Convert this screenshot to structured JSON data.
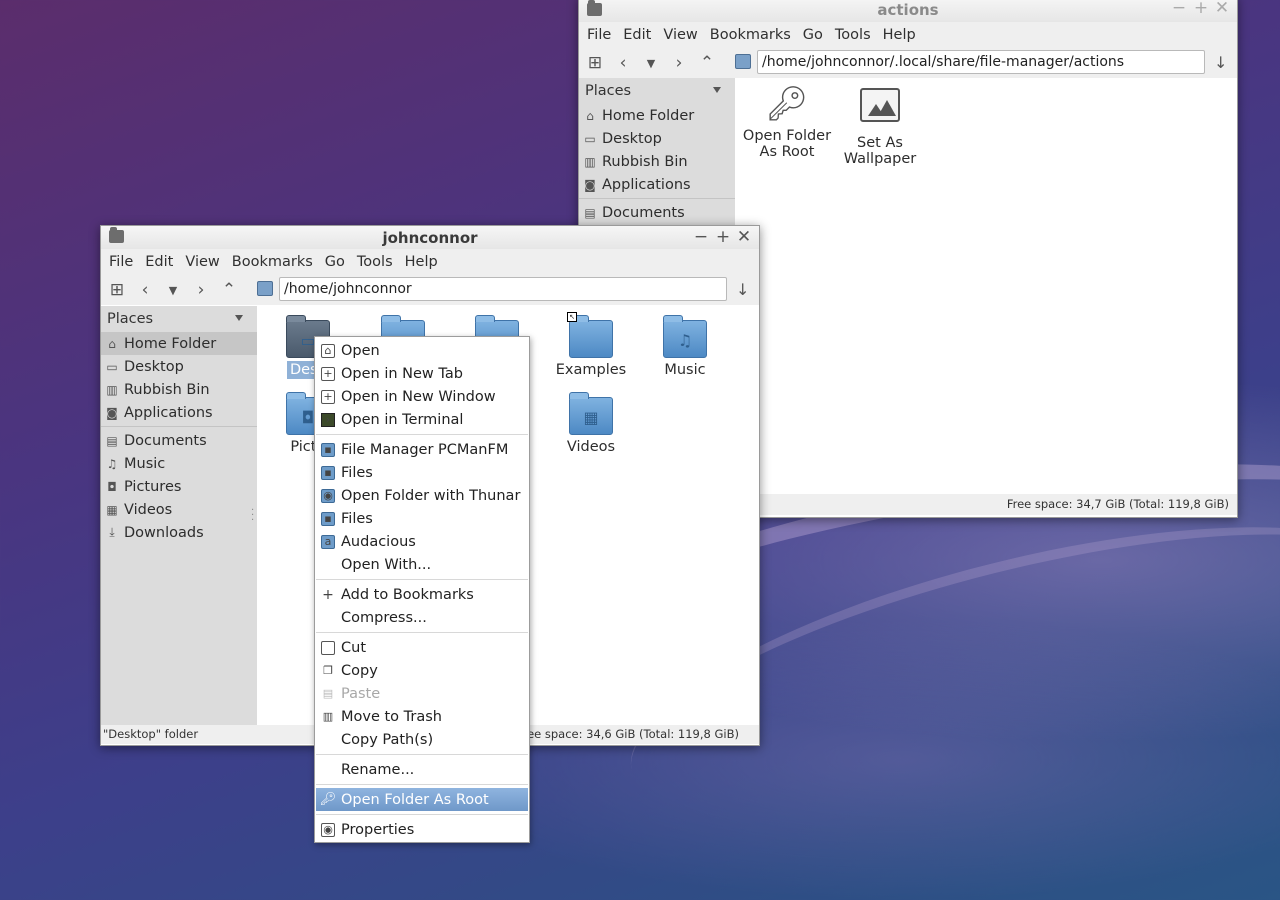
{
  "colors": {
    "selection": "#8fb1d7",
    "menu_highlight": "#7aa3d3",
    "sidebar_bg": "#dcdcdc"
  },
  "back_window": {
    "title": "actions",
    "menu": [
      "File",
      "Edit",
      "View",
      "Bookmarks",
      "Go",
      "Tools",
      "Help"
    ],
    "path": "/home/johnconnor/.local/share/file-manager/actions",
    "places_label": "Places",
    "places": [
      {
        "label": "Home Folder",
        "icon": "home-icon"
      },
      {
        "label": "Desktop",
        "icon": "desktop-icon"
      },
      {
        "label": "Rubbish Bin",
        "icon": "trash-icon"
      },
      {
        "label": "Applications",
        "icon": "applications-icon"
      },
      {
        "label": "Documents",
        "icon": "documents-icon"
      }
    ],
    "items": [
      {
        "label_line1": "Open Folder",
        "label_line2": "As Root",
        "icon": "key-icon"
      },
      {
        "label_line1": "Set As",
        "label_line2": "Wallpaper",
        "icon": "image-icon"
      }
    ],
    "status_free": "Free space: 34,7 GiB (Total: 119,8 GiB)"
  },
  "front_window": {
    "title": "johnconnor",
    "menu": [
      "File",
      "Edit",
      "View",
      "Bookmarks",
      "Go",
      "Tools",
      "Help"
    ],
    "path": "/home/johnconnor",
    "places_label": "Places",
    "places": [
      {
        "label": "Home Folder",
        "icon": "home-icon",
        "selected": true
      },
      {
        "label": "Desktop",
        "icon": "desktop-icon"
      },
      {
        "label": "Rubbish Bin",
        "icon": "trash-icon"
      },
      {
        "label": "Applications",
        "icon": "applications-icon"
      }
    ],
    "bookmarks": [
      {
        "label": "Documents",
        "icon": "documents-icon"
      },
      {
        "label": "Music",
        "icon": "music-icon"
      },
      {
        "label": "Pictures",
        "icon": "pictures-icon"
      },
      {
        "label": "Videos",
        "icon": "videos-icon"
      },
      {
        "label": "Downloads",
        "icon": "downloads-icon"
      }
    ],
    "files": [
      {
        "label": "Desk",
        "icon": "folder-desktop-icon",
        "selected": true
      },
      {
        "label": "",
        "icon": "folder-icon"
      },
      {
        "label": "s",
        "icon": "folder-icon"
      },
      {
        "label": "Examples",
        "icon": "folder-icon"
      },
      {
        "label": "Music",
        "icon": "folder-music-icon"
      },
      {
        "label": "Pictu",
        "icon": "folder-pictures-icon"
      },
      {
        "label": "Videos",
        "icon": "folder-videos-icon"
      }
    ],
    "status_left": "\"Desktop\" folder",
    "status_free": "Free space: 34,6 GiB (Total: 119,8 GiB)"
  },
  "context_menu": {
    "groups": [
      [
        {
          "label": "Open",
          "icon": "open-icon"
        },
        {
          "label": "Open in New Tab",
          "icon": "new-tab-icon"
        },
        {
          "label": "Open in New Window",
          "icon": "new-window-icon"
        },
        {
          "label": "Open in Terminal",
          "icon": "terminal-icon"
        }
      ],
      [
        {
          "label": "File Manager PCManFM",
          "icon": "pcmanfm-icon"
        },
        {
          "label": "Files",
          "icon": "files-icon"
        },
        {
          "label": "Open Folder with Thunar",
          "icon": "thunar-icon"
        },
        {
          "label": "Files",
          "icon": "files-icon"
        },
        {
          "label": "Audacious",
          "icon": "audacious-icon"
        },
        {
          "label": "Open With...",
          "icon": ""
        }
      ],
      [
        {
          "label": "Add to Bookmarks",
          "icon": "plus-icon"
        },
        {
          "label": "Compress...",
          "icon": ""
        }
      ],
      [
        {
          "label": "Cut",
          "icon": "cut-icon"
        },
        {
          "label": "Copy",
          "icon": "copy-icon"
        },
        {
          "label": "Paste",
          "icon": "paste-icon",
          "disabled": true
        },
        {
          "label": "Move to Trash",
          "icon": "trash-icon"
        },
        {
          "label": "Copy Path(s)",
          "icon": ""
        }
      ],
      [
        {
          "label": "Rename...",
          "icon": ""
        }
      ],
      [
        {
          "label": "Open Folder As Root",
          "icon": "key-icon",
          "highlighted": true
        }
      ],
      [
        {
          "label": "Properties",
          "icon": "properties-icon"
        }
      ]
    ]
  }
}
